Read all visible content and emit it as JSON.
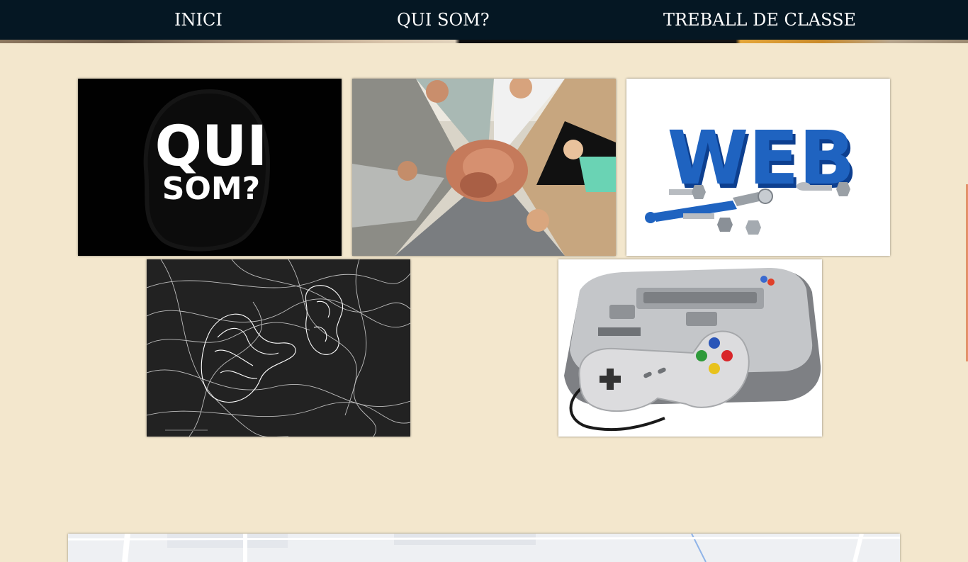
{
  "nav": {
    "items": [
      {
        "label": "INICI"
      },
      {
        "label": "QUI SOM?"
      },
      {
        "label": "TREBALL DE CLASSE"
      }
    ]
  },
  "tiles": [
    {
      "name": "qui-som-image",
      "text_line1": "QUI",
      "text_line2": "SOM?"
    },
    {
      "name": "team-hands-image"
    },
    {
      "name": "web-tools-image",
      "text": "WEB"
    },
    {
      "name": "wire-hand-face-image"
    },
    {
      "name": "snes-console-image"
    }
  ],
  "colors": {
    "background": "#f3e7cd",
    "navbar": "#051723",
    "nav_text": "#ffffff"
  }
}
